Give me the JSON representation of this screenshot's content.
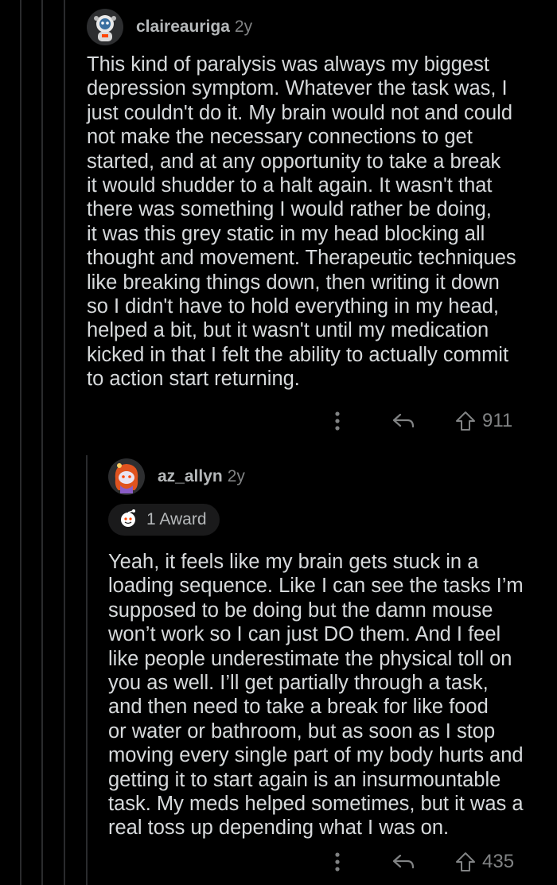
{
  "comments": [
    {
      "username": "claireauriga",
      "age": "2y",
      "avatar": "astronaut-snoo-avatar",
      "lines": [
        "This kind of paralysis was always my biggest",
        "depression symptom. Whatever the task was, I",
        "just couldn't do it. My brain would not and could",
        "not make the necessary connections to get",
        "started, and at any opportunity to take a break",
        "it would shudder to a halt again. It wasn't that",
        "there was something I would rather be doing,",
        "it was this grey static in my head blocking all",
        "thought and movement. Therapeutic techniques",
        "like breaking things down, then writing it down",
        "so I didn't have to hold everything in my head,",
        "helped a bit, but it wasn't until my medication",
        "kicked in that I felt the ability to actually commit",
        "to action start returning."
      ],
      "votes": "911"
    },
    {
      "username": "az_allyn",
      "age": "2y",
      "avatar": "red-hair-snoo-avatar",
      "award": "1 Award",
      "lines": [
        "Yeah, it feels like my brain gets stuck in a",
        "loading sequence. Like I can see the tasks I’m",
        "supposed to be doing but the damn mouse",
        "won’t work so I can just DO them. And I feel",
        "like people underestimate the physical toll on",
        "you as well. I’ll get partially through a task,",
        "and then need to take a break for like food",
        "or water or bathroom, but as soon as I stop",
        "moving every single part of my body hurts and",
        "getting it to start again is an insurmountable",
        "task. My meds helped sometimes, but it was a",
        "real toss up depending what I was on."
      ],
      "votes": "435"
    }
  ],
  "colors": {
    "background": "#000000",
    "text": "#d7dadc",
    "meta": "#818384",
    "thread_line": "#2a2b2d"
  }
}
